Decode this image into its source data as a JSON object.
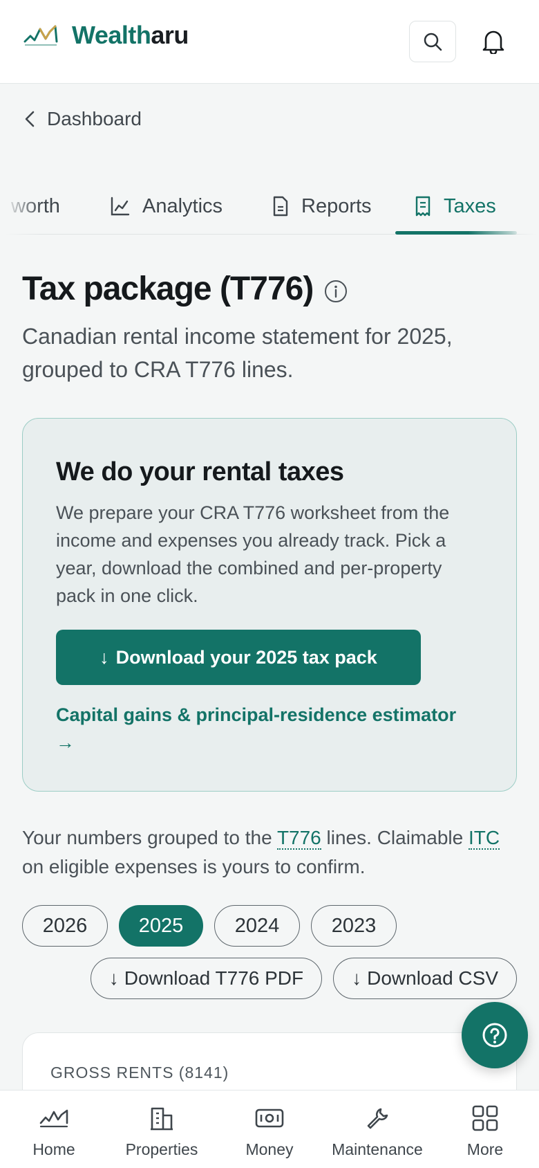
{
  "header": {
    "brand_part1": "Wealth",
    "brand_part2": "aru",
    "logo_icon": "mountain-logo-icon",
    "search_icon": "search-icon",
    "notifications_icon": "bell-icon"
  },
  "back_link": {
    "label": "Dashboard",
    "icon": "chevron-left-icon"
  },
  "tabs": [
    {
      "label": "worth",
      "icon": ""
    },
    {
      "label": "Analytics",
      "icon": "line-chart-icon"
    },
    {
      "label": "Reports",
      "icon": "document-icon"
    },
    {
      "label": "Taxes",
      "icon": "receipt-icon",
      "active": true
    }
  ],
  "page": {
    "title": "Tax package (T776)",
    "info_icon": "info-icon",
    "subtitle": "Canadian rental income statement for 2025, grouped to CRA T776 lines."
  },
  "promo_card": {
    "title": "We do your rental taxes",
    "body": "We prepare your CRA T776 worksheet from the income and expenses you already track. Pick a year, download the combined and per-property pack in one click.",
    "primary_button": "Download your 2025 tax pack",
    "primary_button_arrow": "↓",
    "link": "Capital gains & principal-residence estimator",
    "link_arrow": "→"
  },
  "grouping_note": {
    "part1": "Your numbers grouped to the ",
    "term1": "T776",
    "part2": " lines. Claimable ",
    "term2": "ITC",
    "part3": " on eligible expenses is yours to confirm."
  },
  "years": [
    "2026",
    "2025",
    "2024",
    "2023"
  ],
  "selected_year": "2025",
  "downloads": {
    "pdf": "Download T776 PDF",
    "csv": "Download CSV",
    "arrow": "↓"
  },
  "gross_rents": {
    "label": "GROSS RENTS (8141)"
  },
  "help_fab": {
    "icon": "help-circle-icon"
  },
  "bottom_nav": [
    {
      "label": "Home",
      "icon": "home-chart-icon"
    },
    {
      "label": "Properties",
      "icon": "building-icon"
    },
    {
      "label": "Money",
      "icon": "banknote-icon"
    },
    {
      "label": "Maintenance",
      "icon": "wrench-icon"
    },
    {
      "label": "More",
      "icon": "grid-icon"
    }
  ],
  "colors": {
    "accent": "#137367",
    "background": "#f4f6f6",
    "card_background": "#e8eeee",
    "card_border": "#9ccdc5",
    "text": "#1a1e22"
  }
}
